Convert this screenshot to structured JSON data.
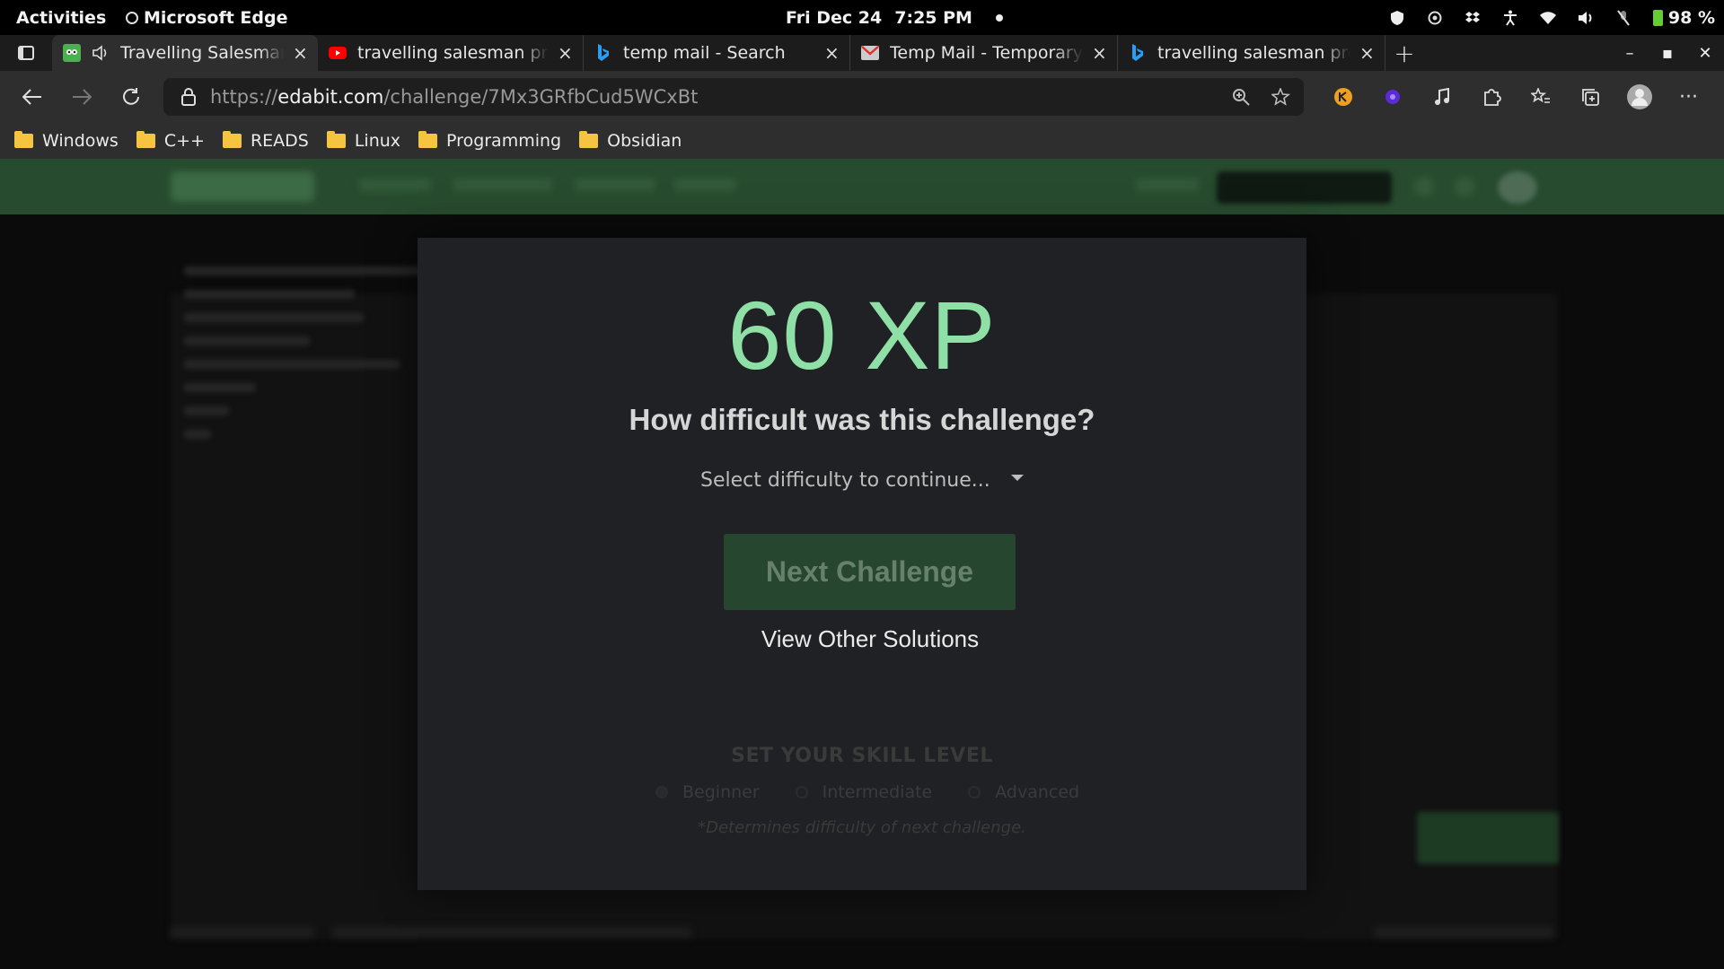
{
  "system_bar": {
    "activities": "Activities",
    "app_name": "Microsoft Edge",
    "date": "Fri Dec 24",
    "time": "7:25 PM",
    "battery": "98 %"
  },
  "tabs": [
    {
      "title": "Travelling Salesman Problem",
      "icon": "edabit-icon",
      "active": true,
      "audio": true
    },
    {
      "title": "travelling salesman problem",
      "icon": "youtube-icon",
      "active": false
    },
    {
      "title": "temp mail - Search",
      "icon": "bing-icon",
      "active": false
    },
    {
      "title": "Temp Mail - Temporary Email",
      "icon": "gmail-icon",
      "active": false
    },
    {
      "title": "travelling salesman problem",
      "icon": "bing-icon",
      "active": false
    }
  ],
  "address_bar": {
    "url_prefix": "https://",
    "url_host": "edabit.com",
    "url_path": "/challenge/7Mx3GRfbCud5WCxBt"
  },
  "bookmarks": [
    "Windows",
    "C++",
    "READS",
    "Linux",
    "Programming",
    "Obsidian"
  ],
  "modal": {
    "xp": "60 XP",
    "question": "How difficult was this challenge?",
    "select_placeholder": "Select difficulty to continue...",
    "next_button": "Next Challenge",
    "view_other": "View Other Solutions",
    "skill_title": "SET YOUR SKILL LEVEL",
    "skill_options": [
      "Beginner",
      "Intermediate",
      "Advanced"
    ],
    "skill_note": "*Determines difficulty of next challenge."
  },
  "colors": {
    "xp_green": "#8ee0a6",
    "button_green": "#27462f",
    "header_green": "#274b2e"
  }
}
